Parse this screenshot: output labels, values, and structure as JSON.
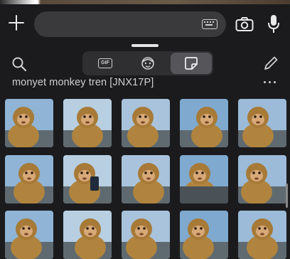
{
  "keyboard": {
    "pack_title": "monyet monkey tren [JNX17P]",
    "tabs": [
      {
        "name": "gif",
        "label": "GIF",
        "selected": false
      },
      {
        "name": "memoji",
        "selected": false
      },
      {
        "name": "stickers",
        "selected": true
      }
    ],
    "icons": {
      "add": "plus-icon",
      "keyboard": "keyboard-icon",
      "camera": "camera-icon",
      "mic": "microphone-icon",
      "search": "search-icon",
      "edit": "pencil-icon",
      "more": "more-icon",
      "memoji": "memoji-face-icon",
      "sticker": "sticker-icon"
    },
    "colors": {
      "background": "#1b1b1d",
      "field": "#3a3a3c",
      "segment_selected": "#56565a"
    }
  },
  "stickers": [
    {
      "desc": "macaque thumbs"
    },
    {
      "desc": "macaque eating"
    },
    {
      "desc": "macaque hands"
    },
    {
      "desc": "macaque tongue"
    },
    {
      "desc": "macaque sitting"
    },
    {
      "desc": "macaque pointing"
    },
    {
      "desc": "macaque phone"
    },
    {
      "desc": "macaque stare"
    },
    {
      "desc": "macaque back"
    },
    {
      "desc": "macaque pair"
    },
    {
      "desc": "macaque close"
    },
    {
      "desc": "macaque look"
    },
    {
      "desc": "macaque face"
    },
    {
      "desc": "macaque wide eyes"
    },
    {
      "desc": "macaque side"
    }
  ]
}
